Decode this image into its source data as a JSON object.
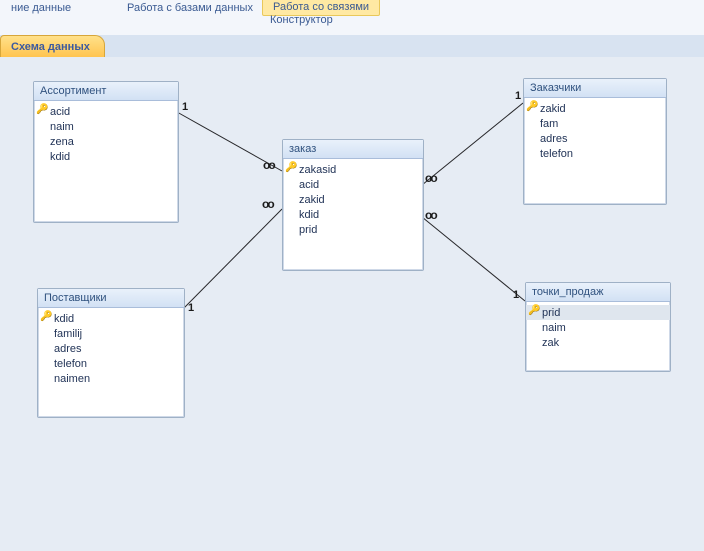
{
  "ribbon": {
    "group_left": "ние данные",
    "group_mid": "Работа с базами данных",
    "tab_active": "Работа со связями",
    "cmd": "Конструктор"
  },
  "tab": {
    "label": "Схема данных"
  },
  "tables": {
    "t1": {
      "title": "Ассортимент",
      "fields": [
        "acid",
        "naim",
        "zena",
        "kdid"
      ],
      "pk": 0
    },
    "t2": {
      "title": "заказ",
      "fields": [
        "zakasid",
        "acid",
        "zakid",
        "kdid",
        "prid"
      ],
      "pk": 0
    },
    "t3": {
      "title": "Заказчики",
      "fields": [
        "zakid",
        "fam",
        "adres",
        "telefon"
      ],
      "pk": 0
    },
    "t4": {
      "title": "Поставщики",
      "fields": [
        "kdid",
        "familij",
        "adres",
        "telefon",
        "naimen"
      ],
      "pk": 0
    },
    "t5": {
      "title": "точки_продаж",
      "fields": [
        "prid",
        "naim",
        "zak"
      ],
      "pk": 0
    }
  },
  "card": {
    "one": "1",
    "many": "∞"
  }
}
